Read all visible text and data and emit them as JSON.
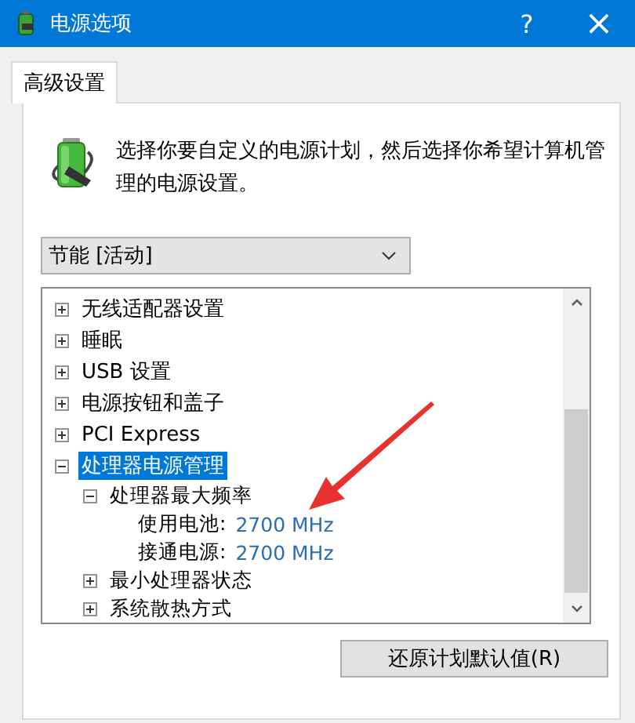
{
  "window": {
    "title": "电源选项",
    "help": "?",
    "close": "×"
  },
  "tabs": [
    {
      "label": "高级设置",
      "selected": true
    }
  ],
  "description": "选择你要自定义的电源计划，然后选择你希望计算机管理的电源设置。",
  "plan_dropdown": {
    "value": "节能 [活动]"
  },
  "tree": [
    {
      "kind": "group",
      "label": "无线适配器设置",
      "expanded": false,
      "selected": false
    },
    {
      "kind": "group",
      "label": "睡眠",
      "expanded": false,
      "selected": false
    },
    {
      "kind": "group",
      "label": "USB 设置",
      "expanded": false,
      "selected": false
    },
    {
      "kind": "group",
      "label": "电源按钮和盖子",
      "expanded": false,
      "selected": false
    },
    {
      "kind": "group",
      "label": "PCI Express",
      "expanded": false,
      "selected": false
    },
    {
      "kind": "group",
      "label": "处理器电源管理",
      "expanded": true,
      "selected": true,
      "children": [
        {
          "kind": "group",
          "label": "处理器最大频率",
          "expanded": true,
          "selected": false,
          "children": [
            {
              "kind": "setting",
              "label": "使用电池:",
              "value": "2700 MHz",
              "selected": false
            },
            {
              "kind": "setting",
              "label": "接通电源:",
              "value": "2700 MHz",
              "selected": false
            }
          ]
        },
        {
          "kind": "group",
          "label": "最小处理器状态",
          "expanded": false,
          "selected": false
        },
        {
          "kind": "group",
          "label": "系统散热方式",
          "expanded": false,
          "selected": false
        }
      ]
    }
  ],
  "buttons": [
    {
      "label": "还原计划默认值(R)"
    }
  ]
}
